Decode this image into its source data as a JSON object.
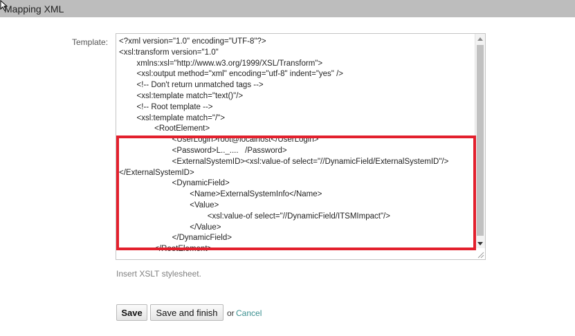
{
  "header": {
    "title": "Mapping XML"
  },
  "form": {
    "template_label": "Template:",
    "template_lines": [
      "<?xml version=\"1.0\" encoding=\"UTF-8\"?>",
      "<xsl:transform version=\"1.0\"",
      "        xmlns:xsl=\"http://www.w3.org/1999/XSL/Transform\">",
      "        <xsl:output method=\"xml\" encoding=\"utf-8\" indent=\"yes\" />",
      "        <!-- Don't return unmatched tags -->",
      "        <xsl:template match=\"text()\"/>",
      "        <!-- Root template -->",
      "        <xsl:template match=\"/\">",
      "                <RootElement>",
      "                        <UserLogin>root@localhost</UserLogin>",
      "                        <Password>L.._....   /Password>",
      "                        <ExternalSystemID><xsl:value-of select=\"//DynamicField/ExternalSystemID\"/>",
      "</ExternalSystemID>",
      "                        <DynamicField>",
      "                                <Name>ExternalSystemInfo</Name>",
      "                                <Value>",
      "                                        <xsl:value-of select=\"//DynamicField/ITSMImpact\"/>",
      "                                </Value>",
      "                        </DynamicField>",
      "                </RootElement>"
    ],
    "hint": "Insert XSLT stylesheet."
  },
  "actions": {
    "save_label": "Save",
    "save_finish_label": "Save and finish",
    "or_text": "or",
    "cancel_label": "Cancel"
  },
  "colors": {
    "header_bg": "#bdbdbd",
    "highlight_border": "#e3202d",
    "link": "#3a8f8f"
  },
  "icons": {
    "cursor": "mouse-pointer-icon",
    "scroll_up": "chevron-up-icon",
    "scroll_down": "chevron-down-icon",
    "resize": "resize-grip-icon"
  }
}
